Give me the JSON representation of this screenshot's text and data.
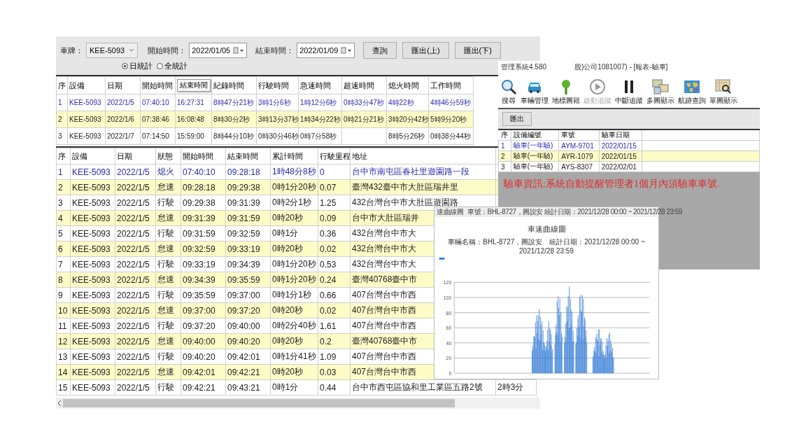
{
  "main_window": {
    "filters": {
      "plate_label": "車牌：",
      "plate_value": "KEE-5093",
      "start_label": "開始時間：",
      "start_value": "2022/01/05",
      "end_label": "結束時間：",
      "end_value": "2022/01/09"
    },
    "buttons": [
      "查詢",
      "匯出(上)",
      "匯出(下)"
    ],
    "radios": [
      {
        "label": "日統計",
        "selected": true
      },
      {
        "label": "全統計",
        "selected": false
      }
    ],
    "summary_table": {
      "columns": [
        {
          "label": "序"
        },
        {
          "label": "設備"
        },
        {
          "label": "日期"
        },
        {
          "label": "開始時間"
        },
        {
          "tooltip": "結束時間"
        },
        {
          "label": "紀錄時間"
        },
        {
          "label": "行駛時間"
        },
        {
          "label": "急速時間"
        },
        {
          "label": "超速時間"
        },
        {
          "label": "熄火時間"
        },
        {
          "label": "工作時間"
        }
      ],
      "rows": [
        {
          "selected": true,
          "cells": [
            "1",
            "KEE-5093",
            "2022/1/5",
            "07:40:10",
            "16:27:31",
            "8時47分21秒",
            "3時1分6秒",
            "1時12分6秒",
            "0時33分47秒",
            "4時22秒",
            "4時46分59秒"
          ]
        },
        {
          "selected": false,
          "cells": [
            "2",
            "KEE-5093",
            "2022/1/6",
            "07:38:46",
            "16:08:48",
            "8時30分2秒",
            "3時13分37秒",
            "1時34分22秒",
            "0時21分21秒",
            "3時20分42秒",
            "5時9分20秒"
          ]
        },
        {
          "selected": false,
          "cells": [
            "3",
            "KEE-5093",
            "2022/1/7",
            "07:14:50",
            "15:59:00",
            "8時44分10秒",
            "0時30分46秒",
            "0時7分58秒",
            "",
            "8時5分26秒",
            "0時38分44秒"
          ]
        }
      ]
    },
    "detail_table": {
      "columns": [
        "序",
        "設備",
        "日期",
        "狀態",
        "開始時間",
        "結束時間",
        "累計時間",
        "行駛里程",
        "地址"
      ],
      "rows": [
        {
          "selected": true,
          "cells": [
            "1",
            "KEE-5093",
            "2022/1/5",
            "熄火",
            "07:40:10",
            "09:28:18",
            "1時48分8秒",
            "0",
            "台中市南屯區春社里遊園路一段"
          ]
        },
        {
          "selected": false,
          "cells": [
            "2",
            "KEE-5093",
            "2022/1/5",
            "怠速",
            "09:28:18",
            "09:29:38",
            "0時1分20秒",
            "0.07",
            "臺灣432臺中市大肚區瑞井里"
          ]
        },
        {
          "selected": false,
          "cells": [
            "3",
            "KEE-5093",
            "2022/1/5",
            "行駛",
            "09:29:38",
            "09:31:39",
            "0時2分1秒",
            "1.25",
            "432台灣台中市大肚區遊園路"
          ]
        },
        {
          "selected": false,
          "cells": [
            "4",
            "KEE-5093",
            "2022/1/5",
            "怠速",
            "09:31:39",
            "09:31:59",
            "0時20秒",
            "0.09",
            "台中市大肚區瑞井"
          ]
        },
        {
          "selected": false,
          "cells": [
            "5",
            "KEE-5093",
            "2022/1/5",
            "行駛",
            "09:31:59",
            "09:32:59",
            "0時1分",
            "0.36",
            "432台灣台中市大"
          ]
        },
        {
          "selected": false,
          "cells": [
            "6",
            "KEE-5093",
            "2022/1/5",
            "怠速",
            "09:32:59",
            "09:33:19",
            "0時20秒",
            "0.02",
            "432台灣台中市大"
          ]
        },
        {
          "selected": false,
          "cells": [
            "7",
            "KEE-5093",
            "2022/1/5",
            "行駛",
            "09:33:19",
            "09:34:39",
            "0時1分20秒",
            "0.53",
            "432台灣台中市大"
          ]
        },
        {
          "selected": false,
          "cells": [
            "8",
            "KEE-5093",
            "2022/1/5",
            "怠速",
            "09:34:39",
            "09:35:59",
            "0時1分20秒",
            "0.24",
            "臺灣40768臺中市"
          ]
        },
        {
          "selected": false,
          "cells": [
            "9",
            "KEE-5093",
            "2022/1/5",
            "行駛",
            "09:35:59",
            "09:37:00",
            "0時1分1秒",
            "0.66",
            "407台灣台中市西"
          ]
        },
        {
          "selected": false,
          "cells": [
            "10",
            "KEE-5093",
            "2022/1/5",
            "怠速",
            "09:37:00",
            "09:37:20",
            "0時20秒",
            "0.02",
            "407台灣台中市西"
          ]
        },
        {
          "selected": false,
          "cells": [
            "11",
            "KEE-5093",
            "2022/1/5",
            "行駛",
            "09:37:20",
            "09:40:00",
            "0時2分40秒",
            "1.61",
            "407台灣台中市西"
          ]
        },
        {
          "selected": false,
          "cells": [
            "12",
            "KEE-5093",
            "2022/1/5",
            "怠速",
            "09:40:00",
            "09:40:20",
            "0時20秒",
            "0.2",
            "臺灣40768臺中市"
          ]
        },
        {
          "selected": false,
          "cells": [
            "13",
            "KEE-5093",
            "2022/1/5",
            "行駛",
            "09:40:20",
            "09:42:01",
            "0時1分41秒",
            "1.09",
            "407台灣台中市西"
          ]
        },
        {
          "selected": false,
          "cells": [
            "14",
            "KEE-5093",
            "2022/1/5",
            "怠速",
            "09:42:01",
            "09:42:21",
            "0時20秒",
            "0.03",
            "407台灣台中市西"
          ]
        },
        {
          "selected": false,
          "cells": [
            "15",
            "KEE-5093",
            "2022/1/5",
            "行駛",
            "09:42:21",
            "09:43:21",
            "0時1分",
            "0.44",
            "台中市西屯區協和里工業區五路2號",
            "2時3分"
          ]
        }
      ]
    }
  },
  "tracking_window": {
    "title": "管理系統4.580",
    "title_suffix": "股)公司1081007) - [報表-驗車]",
    "tools": [
      {
        "label": "搜尋",
        "kind": "search",
        "disabled": false
      },
      {
        "label": "車輛管理",
        "kind": "car",
        "disabled": false
      },
      {
        "label": "地標圖籍",
        "kind": "pin",
        "disabled": false
      },
      {
        "label": "啟動追蹤",
        "kind": "play",
        "disabled": true
      },
      {
        "label": "中斷追蹤",
        "kind": "pause",
        "disabled": false
      },
      {
        "label": "多圖顯示",
        "kind": "maps",
        "disabled": false
      },
      {
        "label": "航跡查詢",
        "kind": "world",
        "disabled": false
      },
      {
        "label": "單圖顯示",
        "kind": "map-search",
        "disabled": false
      }
    ],
    "export_button": "匯出",
    "table": {
      "columns": [
        "序",
        "設備編號",
        "車號",
        "驗車日期"
      ],
      "rows": [
        {
          "selected": true,
          "cells": [
            "1",
            "驗車(一年驗)",
            "AYM-9701",
            "2022/01/15"
          ]
        },
        {
          "selected": false,
          "cells": [
            "2",
            "驗車(一年驗)",
            "AYR-1079",
            "2022/01/15"
          ]
        },
        {
          "selected": false,
          "cells": [
            "3",
            "驗車(一年驗)",
            "AYS-8307",
            "2022/02/01"
          ]
        }
      ]
    },
    "notice": "驗車資訊:系統自動提醒管理者1個月內須驗車車號."
  },
  "chart_window": {
    "title": "速曲線圖",
    "info": "車號：BHL-8727，圖說安 統計日期：2021/12/28 00:00 ~ 2021/12/28 23:59",
    "chart_title": "車速曲線圖",
    "chart_subtitle": "車輛名稱：BHL-8727，圖說安　統計日期：2021/12/28 00:00 ~ 2021/12/28 23:59",
    "y_axis_labels": [
      "120",
      "100",
      "80",
      "60",
      "40",
      "20",
      "0"
    ]
  }
}
